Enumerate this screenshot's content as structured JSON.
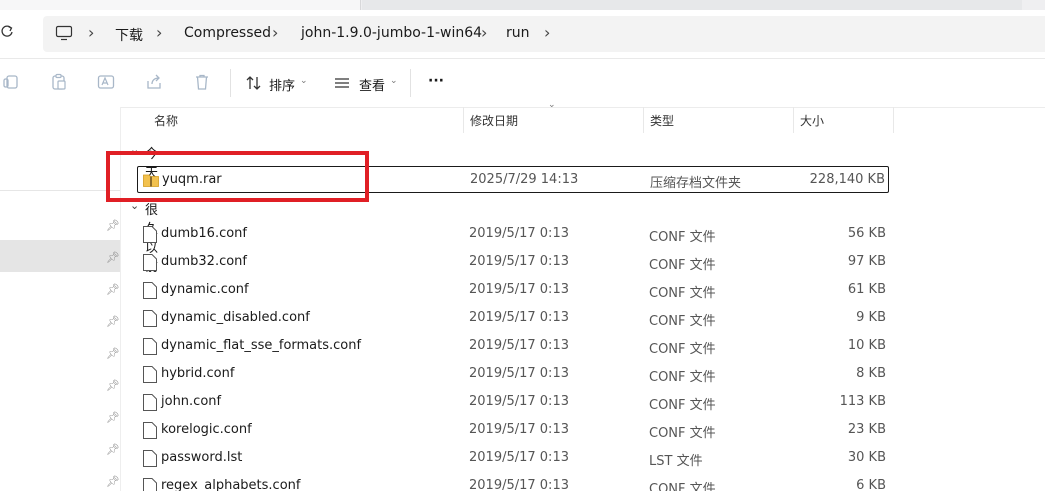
{
  "address": {
    "crumbs": [
      "下载",
      "Compressed",
      "john-1.9.0-jumbo-1-win64",
      "run"
    ]
  },
  "toolbar": {
    "sort_label": "排序",
    "view_label": "查看",
    "more_label": "···"
  },
  "columns": {
    "name": "名称",
    "modified": "修改日期",
    "type": "类型",
    "size": "大小"
  },
  "groups": {
    "today": "今天",
    "long_ago": "很久以前"
  },
  "files": [
    {
      "name": "yuqm.rar",
      "modified": "2025/7/29 14:13",
      "type": "压缩存档文件夹",
      "size": "228,140 KB",
      "icon": "zip-folder-icon"
    },
    {
      "name": "dumb16.conf",
      "modified": "2019/5/17 0:13",
      "type": "CONF 文件",
      "size": "56 KB",
      "icon": "file-icon"
    },
    {
      "name": "dumb32.conf",
      "modified": "2019/5/17 0:13",
      "type": "CONF 文件",
      "size": "97 KB",
      "icon": "file-icon"
    },
    {
      "name": "dynamic.conf",
      "modified": "2019/5/17 0:13",
      "type": "CONF 文件",
      "size": "61 KB",
      "icon": "file-icon"
    },
    {
      "name": "dynamic_disabled.conf",
      "modified": "2019/5/17 0:13",
      "type": "CONF 文件",
      "size": "9 KB",
      "icon": "file-icon"
    },
    {
      "name": "dynamic_flat_sse_formats.conf",
      "modified": "2019/5/17 0:13",
      "type": "CONF 文件",
      "size": "10 KB",
      "icon": "file-icon"
    },
    {
      "name": "hybrid.conf",
      "modified": "2019/5/17 0:13",
      "type": "CONF 文件",
      "size": "8 KB",
      "icon": "file-icon"
    },
    {
      "name": "john.conf",
      "modified": "2019/5/17 0:13",
      "type": "CONF 文件",
      "size": "113 KB",
      "icon": "file-icon"
    },
    {
      "name": "korelogic.conf",
      "modified": "2019/5/17 0:13",
      "type": "CONF 文件",
      "size": "23 KB",
      "icon": "file-icon"
    },
    {
      "name": "password.lst",
      "modified": "2019/5/17 0:13",
      "type": "LST 文件",
      "size": "30 KB",
      "icon": "file-icon"
    },
    {
      "name": "regex_alphabets.conf",
      "modified": "2019/5/17 0:13",
      "type": "CONF 文件",
      "size": "6 KB",
      "icon": "file-icon"
    }
  ],
  "colors": {
    "annotation": "#e01f25",
    "folder_yellow": "#f2c14e",
    "nav_selected": "#e5e5e5"
  }
}
